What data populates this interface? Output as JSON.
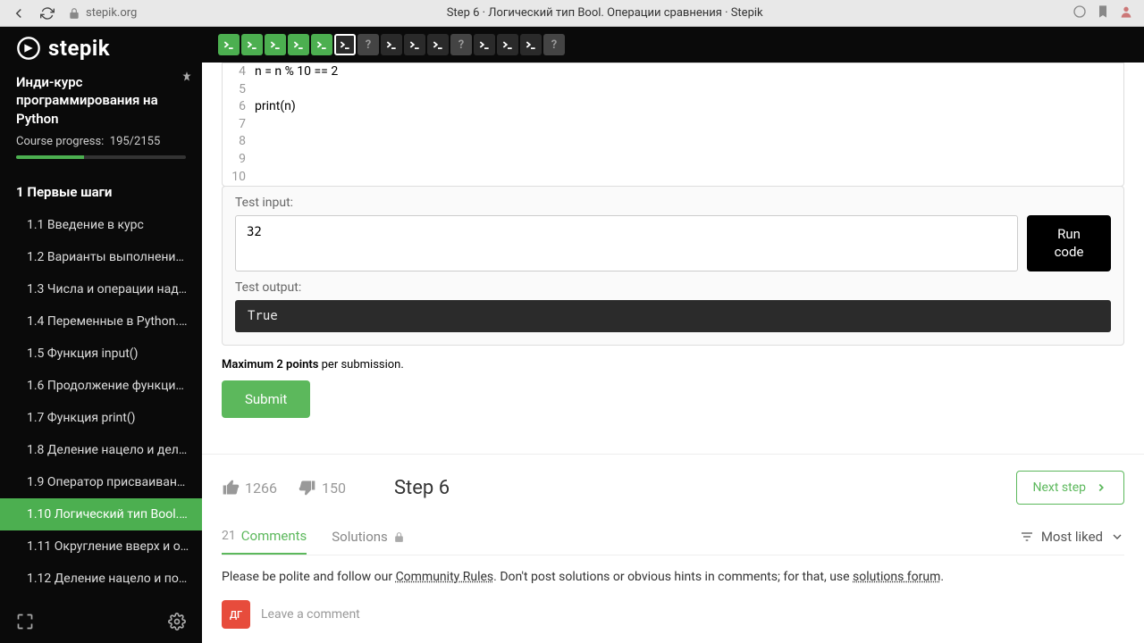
{
  "browser": {
    "url": "stepik.org",
    "title": "Step 6 · Логический тип Bool. Операции сравнения · Stepik"
  },
  "sidebar": {
    "logo": "stepik",
    "course_title": "Инди-курс программирования на Python",
    "progress_label": "Course progress:",
    "progress_value": "195/2155",
    "section": "1  Первые шаги",
    "lessons": [
      {
        "num": "1.1",
        "title": "Введение в курс"
      },
      {
        "num": "1.2",
        "title": "Варианты выполнения…"
      },
      {
        "num": "1.3",
        "title": "Числа и операции над …"
      },
      {
        "num": "1.4",
        "title": "Переменные в Python. …"
      },
      {
        "num": "1.5",
        "title": "Функция input()"
      },
      {
        "num": "1.6",
        "title": "Продолжение функции…"
      },
      {
        "num": "1.7",
        "title": "Функция print()"
      },
      {
        "num": "1.8",
        "title": "Деление нацело и дел…"
      },
      {
        "num": "1.9",
        "title": "Оператор присваивани…"
      },
      {
        "num": "1.10",
        "title": "Логический тип Bool. …"
      },
      {
        "num": "1.11",
        "title": "Округление вверх и о…"
      },
      {
        "num": "1.12",
        "title": "Деление нацело и по …"
      }
    ]
  },
  "code": {
    "lines": [
      {
        "n": "4",
        "text": "n = n % 10 == 2"
      },
      {
        "n": "5",
        "text": ""
      },
      {
        "n": "6",
        "text": "print(n)"
      },
      {
        "n": "7",
        "text": ""
      },
      {
        "n": "8",
        "text": ""
      },
      {
        "n": "9",
        "text": ""
      },
      {
        "n": "10",
        "text": ""
      }
    ]
  },
  "test": {
    "input_label": "Test input:",
    "input_value": "32",
    "output_label": "Test output:",
    "output_value": "True",
    "run_label": "Run code"
  },
  "points": {
    "bold": "Maximum 2 points",
    "rest": " per submission."
  },
  "submit_label": "Submit",
  "footer": {
    "likes": "1266",
    "dislikes": "150",
    "step_label": "Step 6",
    "next_label": "Next step"
  },
  "tabs": {
    "comments_count": "21",
    "comments_label": "Comments",
    "solutions_label": "Solutions",
    "sort_label": "Most liked"
  },
  "rules": {
    "prefix": "Please be polite and follow our ",
    "link1": "Community Rules",
    "mid": ". Don't post solutions or obvious hints in comments; for that, use ",
    "link2": "solutions forum",
    "suffix": "."
  },
  "comment": {
    "avatar": "ДГ",
    "placeholder": "Leave a comment"
  }
}
